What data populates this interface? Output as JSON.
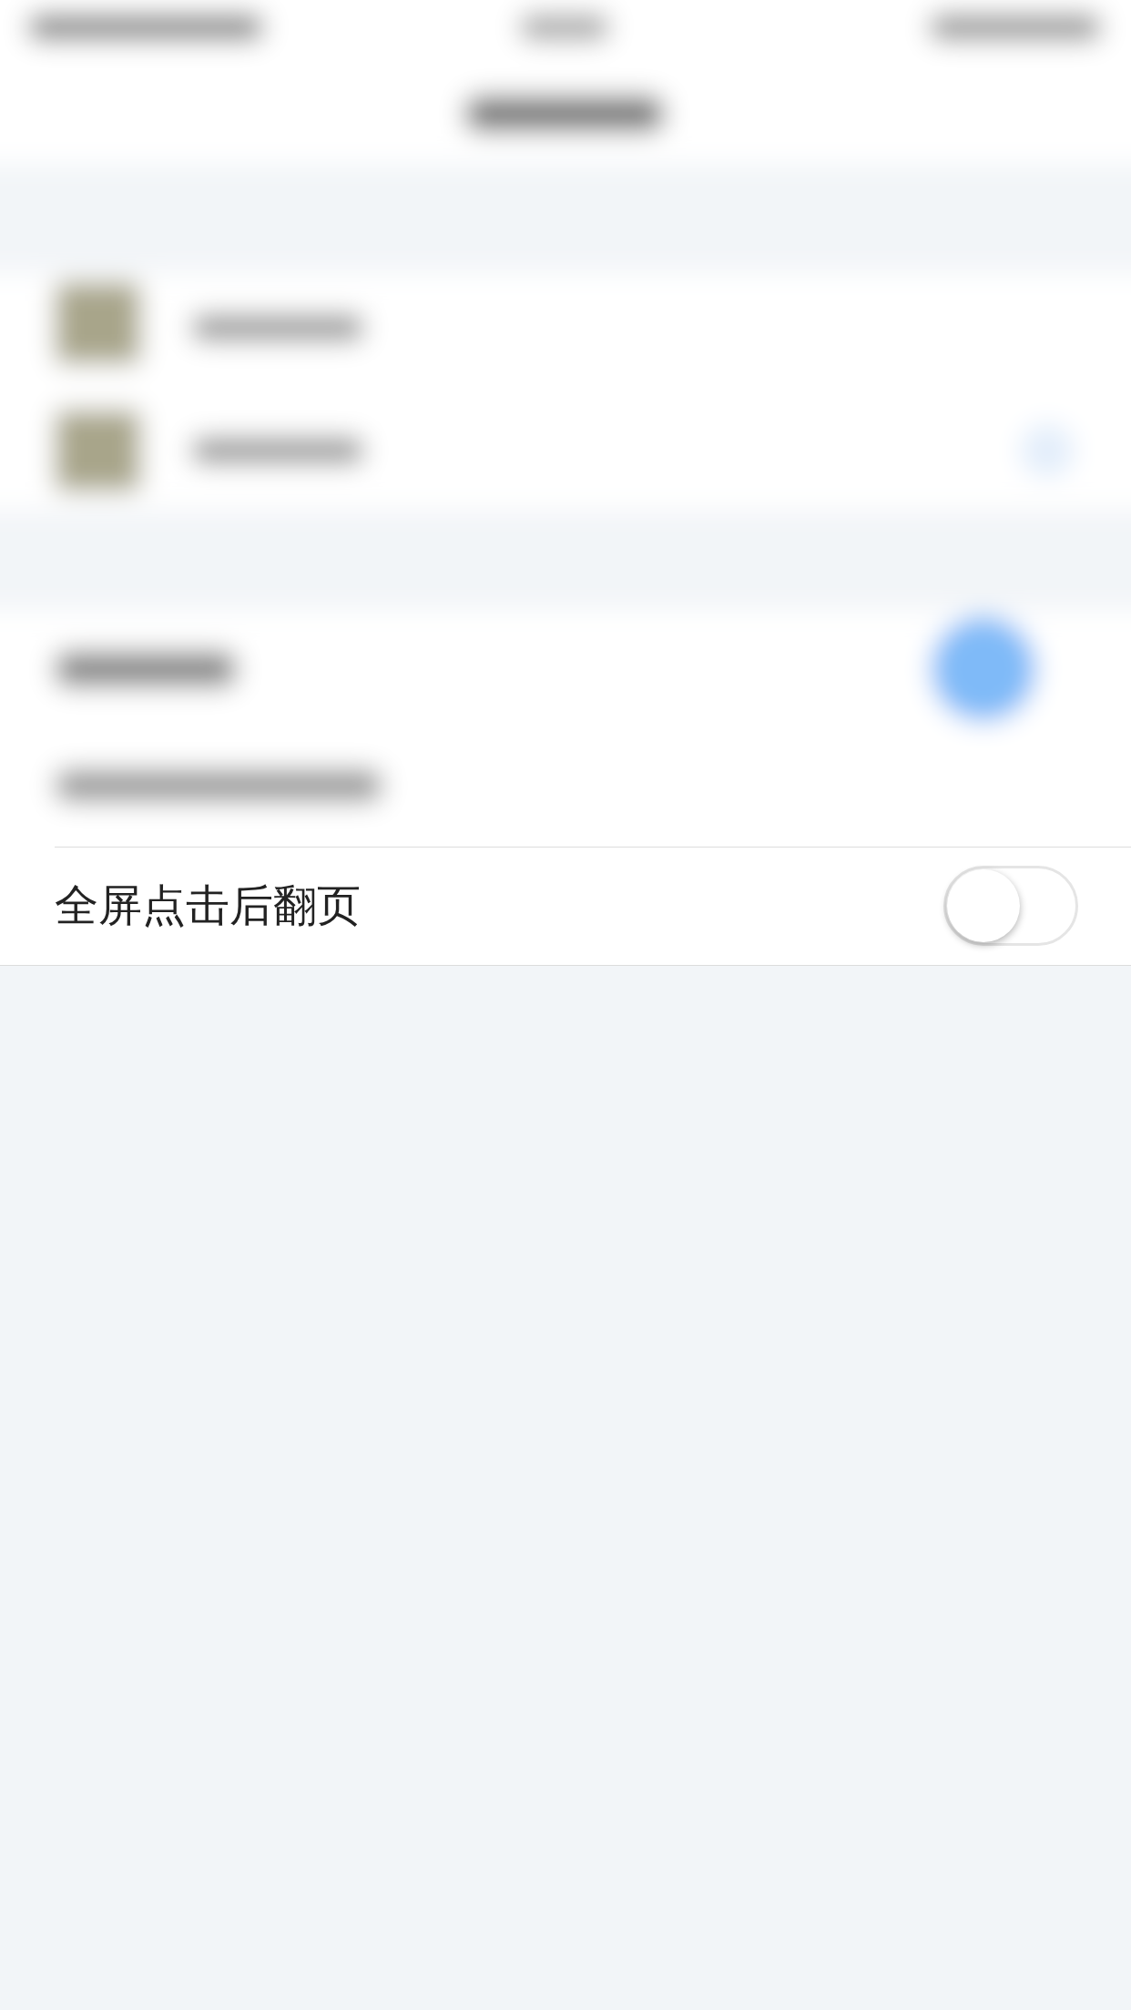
{
  "setting": {
    "label": "全屏点击后翻页",
    "on": false
  }
}
